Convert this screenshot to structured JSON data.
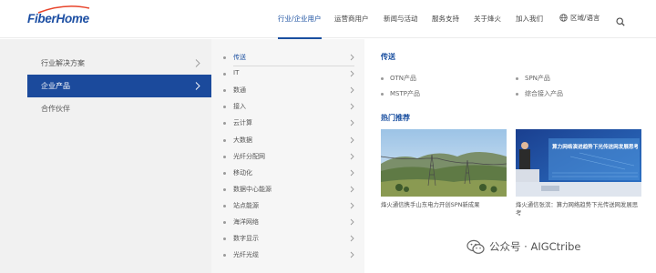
{
  "brand": {
    "logo_text": "FiberHome",
    "logo_color": "#1d4fa3",
    "swoosh_color": "#e8452c"
  },
  "nav": {
    "items": [
      {
        "label": "行业/企业用户",
        "active": true
      },
      {
        "label": "运营商用户"
      },
      {
        "label": "新闻与活动"
      },
      {
        "label": "服务支持"
      },
      {
        "label": "关于烽火"
      },
      {
        "label": "加入我们"
      }
    ],
    "language_label": "区域/语言",
    "language_icon": "globe-icon",
    "search_icon": "search-icon"
  },
  "left_menu": {
    "items": [
      {
        "label": "行业解决方案",
        "chevron": true
      },
      {
        "label": "企业产品",
        "chevron": true,
        "active": true
      },
      {
        "label": "合作伙伴",
        "chevron": false
      }
    ]
  },
  "mid_menu": {
    "items": [
      {
        "label": "传送",
        "active": true
      },
      {
        "label": "IT"
      },
      {
        "label": "数通"
      },
      {
        "label": "接入"
      },
      {
        "label": "云计算"
      },
      {
        "label": "大数据"
      },
      {
        "label": "光纤分配网"
      },
      {
        "label": "移动化"
      },
      {
        "label": "数据中心能源"
      },
      {
        "label": "站点能源"
      },
      {
        "label": "海洋网络"
      },
      {
        "label": "数字显示"
      },
      {
        "label": "光纤光缆"
      }
    ]
  },
  "content": {
    "section_title": "传送",
    "products": [
      "OTN产品",
      "SPN产品",
      "MSTP产品",
      "综合接入产品"
    ],
    "hot_title": "热门推荐",
    "news": [
      {
        "caption": "烽火通信携手山东电力开创SPN新成果"
      },
      {
        "caption": "烽火通信张滨：算力网络趋势下光传送网发展思考",
        "image_banner": "算力网络演进趋势下光传送网发展思考"
      }
    ]
  },
  "watermark": {
    "text": "公众号 · AIGCtribe"
  },
  "colors": {
    "accent": "#1a4fa0",
    "active_bg": "#1b4a9c",
    "left_bg": "#f1f1f1",
    "mid_bg": "#f6f6f6"
  }
}
